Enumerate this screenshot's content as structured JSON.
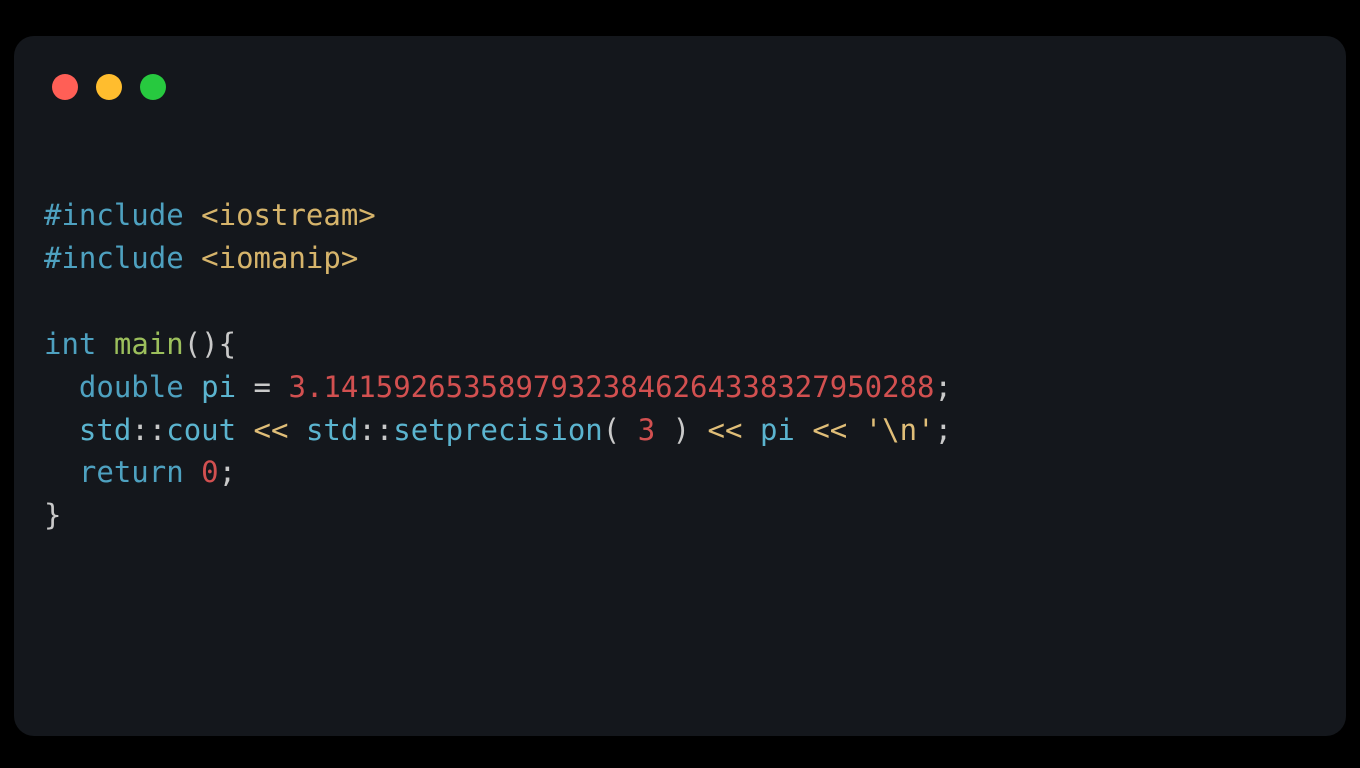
{
  "traffic_lights": {
    "red": "#ff5f56",
    "yellow": "#ffbd2e",
    "green": "#27c93f"
  },
  "code": {
    "preproc": {
      "include_kw": "#include",
      "header1": "<iostream>",
      "header2": "<iomanip>"
    },
    "ret_type": "int",
    "fn_name": "main",
    "fn_parens": "(){",
    "decl_type": "double",
    "decl_name": "pi",
    "decl_eq": " = ",
    "pi_value": "3.1415926535897932384626433832795028",
    "pi_suffix": "8",
    "semi": ";",
    "ns": "std",
    "scope": "::",
    "cout": "cout",
    "shl": "<<",
    "setprec": "setprecision",
    "lpar": "( ",
    "prec_arg": "3",
    "rpar": " )",
    "pi_ref": "pi",
    "nl_char": "'\\n'",
    "return_kw": "return",
    "return_val": "0",
    "close_brace": "}"
  }
}
